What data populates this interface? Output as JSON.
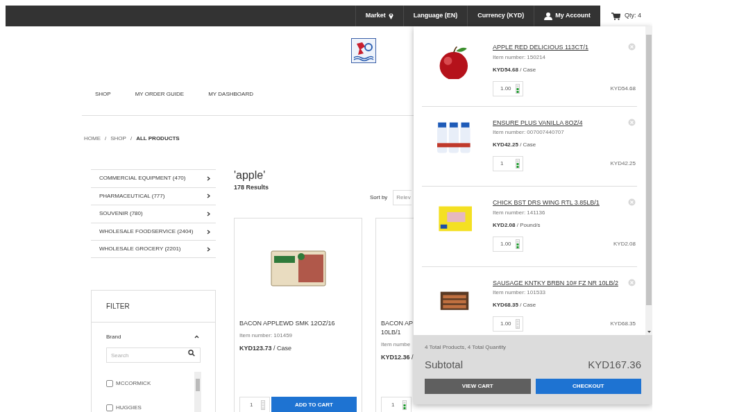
{
  "top_bar": {
    "links": [
      {
        "kind": "market",
        "label": "Market"
      },
      {
        "kind": "plain",
        "label": "Language (EN)"
      },
      {
        "kind": "plain",
        "label": "Currency (KYD)"
      },
      {
        "kind": "account",
        "label": "My Account"
      }
    ],
    "cart": {
      "label": "Qty: 4",
      "expanded": true
    }
  },
  "nav": [
    "SHOP",
    "MY ORDER GUIDE",
    "MY DASHBOARD"
  ],
  "breadcrumb": [
    {
      "label": "HOME",
      "current": false
    },
    {
      "separator": "/",
      "label": "SHOP",
      "current": false
    },
    {
      "separator": "/",
      "label": "ALL PRODUCTS",
      "current": true
    }
  ],
  "categories": [
    "COMMERCIAL EQUIPMENT (470)",
    "PHARMACEUTICAL (777)",
    "SOUVENIR (780)",
    "WHOLESALE FOODSERVICE (2404)",
    "WHOLESALE GROCERY (2201)"
  ],
  "filter": {
    "title": "FILTER",
    "facet": {
      "title": "Brand",
      "expanded": true,
      "placeholder": "Search",
      "options": [
        {
          "label": "MCCORMICK",
          "checked": false
        },
        {
          "label": "HUGGIES",
          "checked": false
        }
      ]
    }
  },
  "search": {
    "query": "'apple'",
    "results": "178 Results"
  },
  "sort": {
    "label": "Sort by",
    "value": "Relev"
  },
  "products": [
    {
      "name_lines": [
        "BACON APPLEWD SMK 12OZ/16"
      ],
      "item_number": "Item number: 101459",
      "price": "KYD123.73",
      "unit": "/ Case",
      "quantity": "1",
      "button": "ADD TO CART"
    },
    {
      "name_lines": [
        "BACON AP",
        "10LB/1"
      ],
      "item_number": "Item numbe",
      "price": "KYD12.36",
      "unit": "/",
      "quantity": "1"
    }
  ],
  "cart": {
    "items": [
      {
        "name": "APPLE RED DELICIOUS 113CT/1",
        "item_number": "Item number: 150214",
        "price": "KYD54.68",
        "unit": "/ Case",
        "quantity": "1.00",
        "total": "KYD54.68",
        "kind": "apple"
      },
      {
        "name": "ENSURE PLUS VANILLA 8OZ/4",
        "item_number": "Item number: 007007440707",
        "price": "KYD42.25",
        "unit": "/ Case",
        "quantity": "1",
        "total": "KYD42.25",
        "kind": "bottles"
      },
      {
        "name": "CHICK BST DRS WING RTL 3.85LB/1",
        "item_number": "Item number: 141136",
        "price": "KYD2.08",
        "unit": "/ Pound/s",
        "quantity": "1.00",
        "total": "KYD2.08",
        "kind": "pack"
      },
      {
        "name": "SAUSAGE KNTKY BRBN 10# FZ NR 10LB/2",
        "item_number": "Item number: 101533",
        "price": "KYD68.35",
        "unit": "/ Case",
        "quantity": "1.00",
        "total": "KYD68.35",
        "kind": "sausage"
      }
    ],
    "summary": "4 Total Products, 4 Total Quantity",
    "subtotal_label": "Subtotal",
    "subtotal": "KYD167.36",
    "buttons": [
      {
        "kind": "secondary",
        "label": "VIEW CART"
      },
      {
        "kind": "primary",
        "label": "CHECKOUT"
      }
    ]
  }
}
